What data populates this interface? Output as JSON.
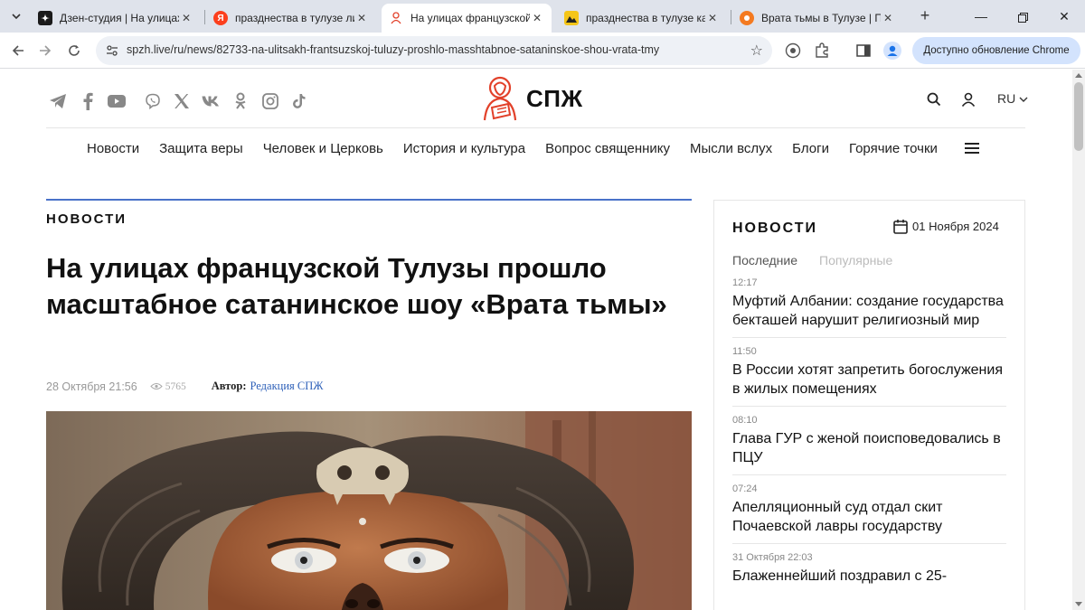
{
  "browser": {
    "tabs": [
      {
        "title": "Дзен-студия | На улицах Тулузы",
        "favicon_color": "#1a1a1a",
        "favicon_glyph": "+",
        "active": false
      },
      {
        "title": "празднества в тулузе лилит",
        "favicon_color": "#fc3f1d",
        "favicon_glyph": "Я",
        "active": false
      },
      {
        "title": "На улицах французской Тулузы",
        "favicon_color": "#ffffff",
        "favicon_glyph": "",
        "active": true
      },
      {
        "title": "празднества в тулузе картинки",
        "favicon_color": "#f5c518",
        "favicon_glyph": "",
        "active": false
      },
      {
        "title": "Врата тьмы в Тулузе | Пикабу",
        "favicon_color": "#f47a20",
        "favicon_glyph": "",
        "active": false
      }
    ],
    "url": "spzh.live/ru/news/82733-na-ulitsakh-frantsuzskoj-tuluzy-proshlo-masshtabnoe-sataninskoe-shou-vrata-tmy",
    "update_label": "Доступно обновление Chrome"
  },
  "site": {
    "logo_text": "СПЖ",
    "lang": "RU",
    "nav": [
      "Новости",
      "Защита веры",
      "Человек и Церковь",
      "История и культура",
      "Вопрос священнику",
      "Мысли вслух",
      "Блоги",
      "Горячие точки"
    ]
  },
  "article": {
    "section": "НОВОСТИ",
    "title": "На улицах французской Тулузы прошло масштабное сатанинское шоу «Врата тьмы»",
    "date": "28 Октября 21:56",
    "views": "5765",
    "author_label": "Автор:",
    "author_name": "Редакция СПЖ"
  },
  "sidebar": {
    "title": "НОВОСТИ",
    "date": "01 Ноября 2024",
    "tab_latest": "Последние",
    "tab_popular": "Популярные",
    "items": [
      {
        "time": "12:17",
        "text": "Муфтий Албании: создание государства бекташей нарушит религиозный мир"
      },
      {
        "time": "11:50",
        "text": "В России хотят запретить богослужения в жилых помещениях"
      },
      {
        "time": "08:10",
        "text": "Глава ГУР с женой поисповедовались в ПЦУ"
      },
      {
        "time": "07:24",
        "text": "Апелляционный суд отдал скит Почаевской лавры государству"
      },
      {
        "time": "31 Октября 22:03",
        "text": "Блаженнейший поздравил с 25-"
      }
    ]
  }
}
